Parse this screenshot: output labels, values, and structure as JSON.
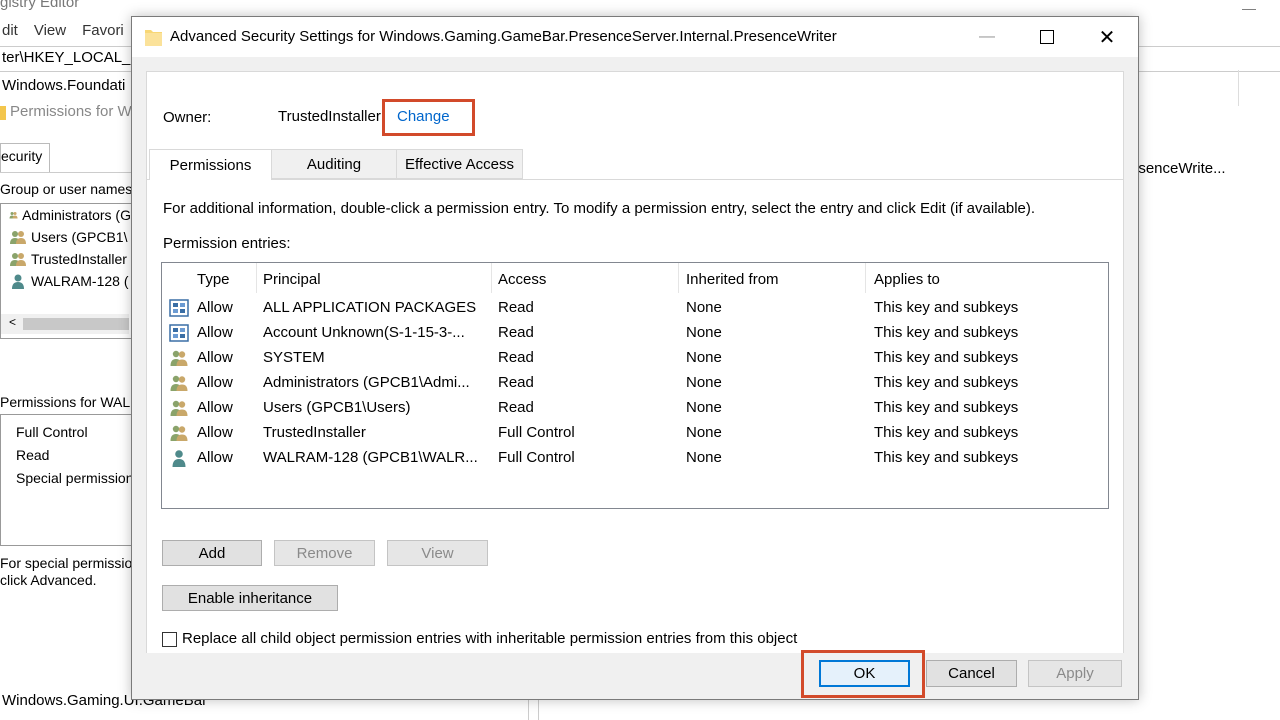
{
  "background": {
    "app_title": "Registry Editor",
    "app_title_partial": "gistry Editor",
    "menu": [
      "dit",
      "View",
      "Favori"
    ],
    "address": "ter\\HKEY_LOCAL_M",
    "selected_key": "Windows.Foundati",
    "permissions_title": "Permissions for W",
    "security_tab": "ecurity",
    "group_label": "Group or user names:",
    "groups": [
      "Administrators (G",
      "Users (GPCB1\\",
      "TrustedInstaller",
      "WALRAM-128 ("
    ],
    "permissions_for": "Permissions for WALI",
    "perm_items": [
      "Full Control",
      "Read",
      "Special permissions"
    ],
    "special_line1": "For special permission",
    "special_line2": "click Advanced.",
    "bottom_key": "Windows.Gaming.UI.GameBar",
    "right_text": "esenceWrite..."
  },
  "dialog": {
    "title": "Advanced Security Settings for Windows.Gaming.GameBar.PresenceServer.Internal.PresenceWriter",
    "minimize": "—",
    "maximize": "☐",
    "close": "✕",
    "owner_label": "Owner:",
    "owner_value": "TrustedInstaller",
    "change_link": "Change",
    "tabs": [
      "Permissions",
      "Auditing",
      "Effective Access"
    ],
    "info_text": "For additional information, double-click a permission entry. To modify a permission entry, select the entry and click Edit (if available).",
    "entries_label": "Permission entries:",
    "columns": [
      "Type",
      "Principal",
      "Access",
      "Inherited from",
      "Applies to"
    ],
    "rows": [
      {
        "type": "Allow",
        "principal": "ALL APPLICATION PACKAGES",
        "access": "Read",
        "inherited": "None",
        "applies": "This key and subkeys",
        "icon": "package-icon"
      },
      {
        "type": "Allow",
        "principal": "Account Unknown(S-1-15-3-...",
        "access": "Read",
        "inherited": "None",
        "applies": "This key and subkeys",
        "icon": "package-icon"
      },
      {
        "type": "Allow",
        "principal": "SYSTEM",
        "access": "Read",
        "inherited": "None",
        "applies": "This key and subkeys",
        "icon": "group-icon"
      },
      {
        "type": "Allow",
        "principal": "Administrators (GPCB1\\Admi...",
        "access": "Read",
        "inherited": "None",
        "applies": "This key and subkeys",
        "icon": "group-icon"
      },
      {
        "type": "Allow",
        "principal": "Users (GPCB1\\Users)",
        "access": "Read",
        "inherited": "None",
        "applies": "This key and subkeys",
        "icon": "group-icon"
      },
      {
        "type": "Allow",
        "principal": "TrustedInstaller",
        "access": "Full Control",
        "inherited": "None",
        "applies": "This key and subkeys",
        "icon": "group-icon"
      },
      {
        "type": "Allow",
        "principal": "WALRAM-128 (GPCB1\\WALR...",
        "access": "Full Control",
        "inherited": "None",
        "applies": "This key and subkeys",
        "icon": "user-icon"
      }
    ],
    "add_button": "Add",
    "remove_button": "Remove",
    "view_button": "View",
    "enable_inheritance_button": "Enable inheritance",
    "replace_checkbox_label": "Replace all child object permission entries with inheritable permission entries from this object",
    "ok_button": "OK",
    "cancel_button": "Cancel",
    "apply_button": "Apply"
  },
  "colors": {
    "accent": "#0078d7",
    "link": "#0066cc",
    "highlight_box": "#d24a2a"
  }
}
